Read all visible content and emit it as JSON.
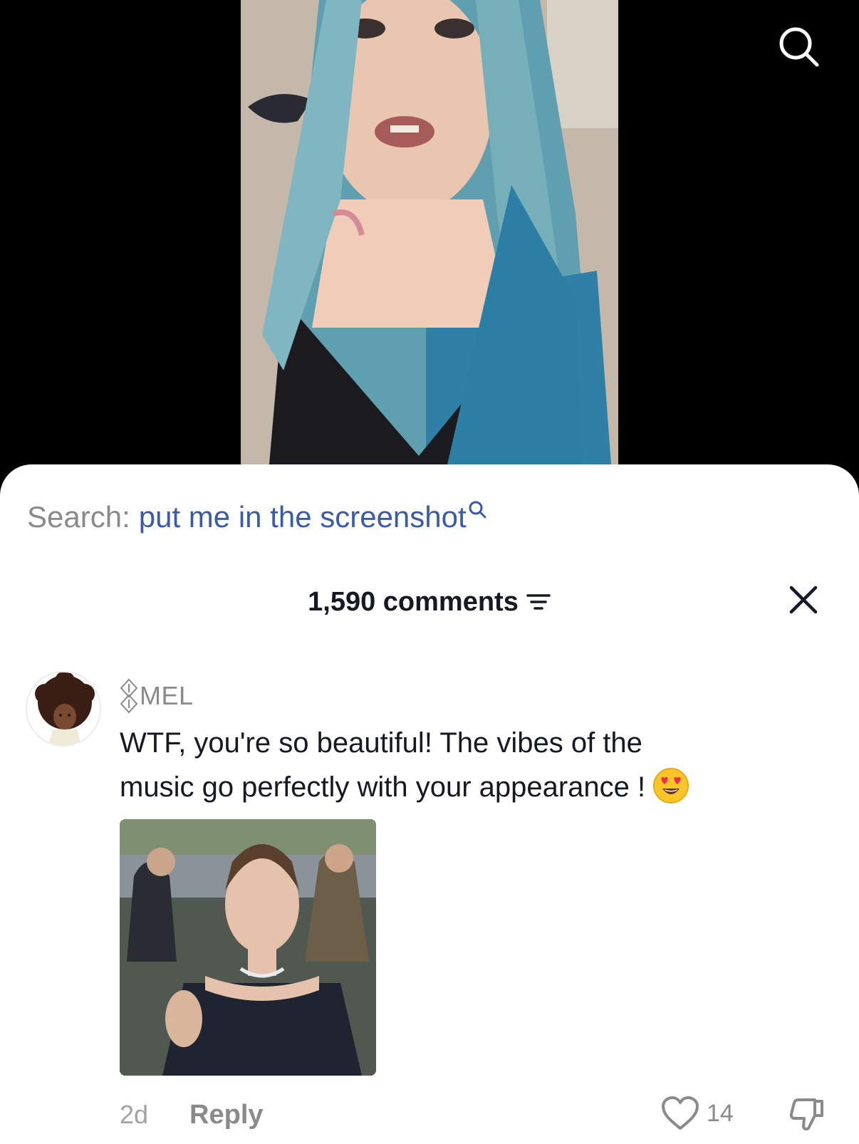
{
  "video": {
    "search_icon": "search-icon"
  },
  "sheet": {
    "search_prefix": "Search:",
    "search_query": "put me in the screenshot",
    "comments_count": "1,590 comments",
    "filter_icon": "filter-icon",
    "close_icon": "close-icon"
  },
  "comment": {
    "username": "MEL",
    "text_line1": "WTF, you're so beautiful! The vibes of the",
    "text_line2": "music go perfectly with your appearance !",
    "emoji": "heart-eyes-emoji",
    "timestamp": "2d",
    "reply_label": "Reply",
    "like_count": "14"
  },
  "colors": {
    "link_blue": "#3a5ba8",
    "muted_gray": "#8a8a8a",
    "text_dark": "#161823"
  }
}
